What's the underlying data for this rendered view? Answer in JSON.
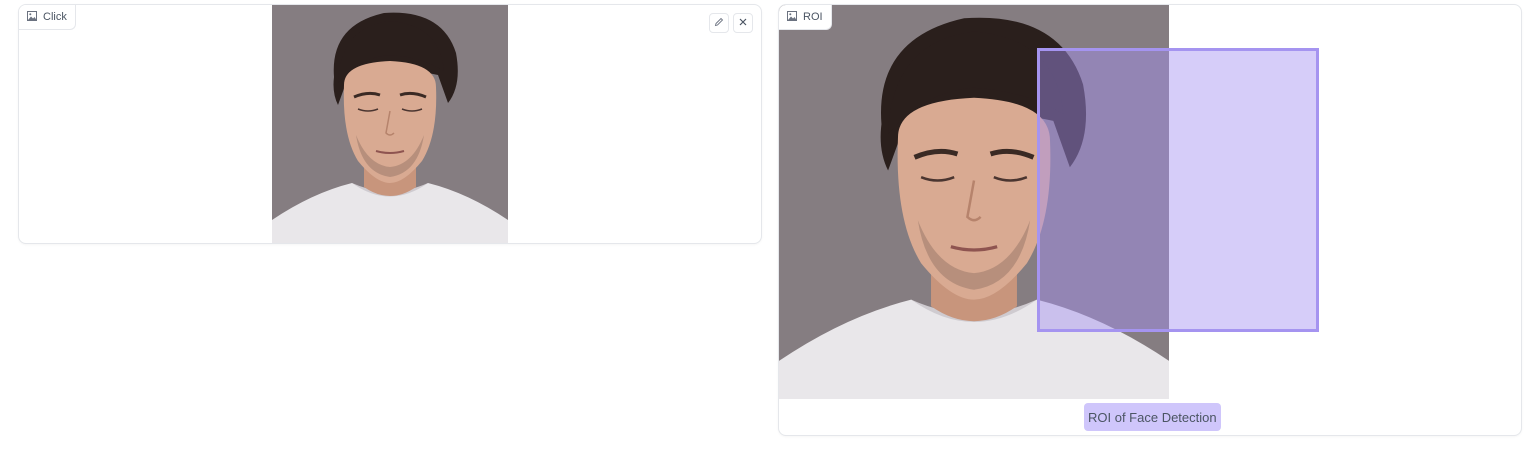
{
  "click_panel": {
    "label": "Click",
    "label_icon": "image-icon",
    "tools": {
      "edit_icon": "pencil-icon",
      "clear_icon": "close-icon"
    }
  },
  "roi_panel": {
    "label": "ROI",
    "label_icon": "image-icon",
    "legend": "ROI of Face Detection",
    "roi_color": "#a594f0"
  },
  "colors": {
    "photo_background": "#857d81",
    "shirt": "#e9e7ea",
    "skin": "#d9aa92",
    "hair": "#2a1f1c"
  }
}
